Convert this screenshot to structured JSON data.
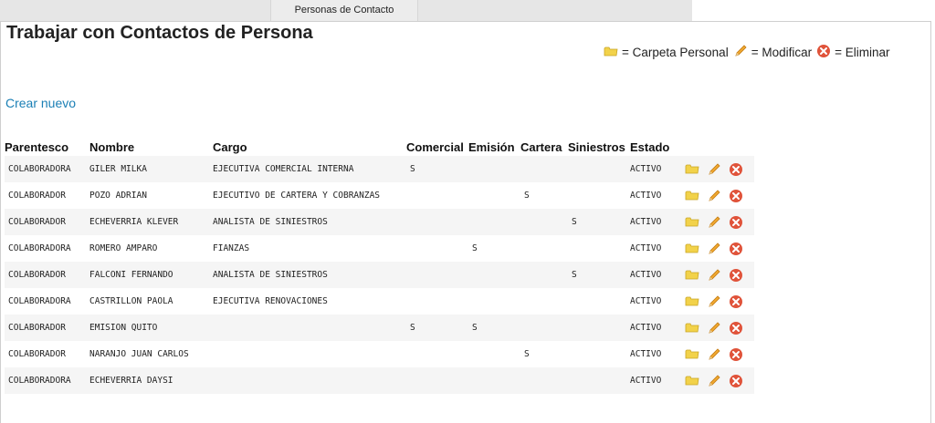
{
  "tabbar": {
    "active_tab": "Personas de Contacto"
  },
  "page": {
    "title": "Trabajar con Contactos de Persona",
    "create_link": "Crear nuevo"
  },
  "legend": {
    "folder_label": "= Carpeta Personal",
    "edit_label": "= Modificar",
    "delete_label": "= Eliminar",
    "folder_icon": "folder-icon",
    "edit_icon": "pencil-icon",
    "delete_icon": "delete-icon"
  },
  "table": {
    "headers": [
      "Parentesco",
      "Nombre",
      "Cargo",
      "Comercial",
      "Emisión",
      "Cartera",
      "Siniestros",
      "Estado"
    ],
    "rows": [
      {
        "parentesco": "COLABORADORA",
        "nombre": "GILER MILKA",
        "cargo": "EJECUTIVA COMERCIAL INTERNA",
        "comercial": "S",
        "emision": "",
        "cartera": "",
        "siniestros": "",
        "estado": "ACTIVO"
      },
      {
        "parentesco": "COLABORADOR",
        "nombre": "POZO ADRIAN",
        "cargo": "EJECUTIVO DE CARTERA Y COBRANZAS",
        "comercial": "",
        "emision": "",
        "cartera": "S",
        "siniestros": "",
        "estado": "ACTIVO"
      },
      {
        "parentesco": "COLABORADOR",
        "nombre": "ECHEVERRIA KLEVER",
        "cargo": "ANALISTA DE SINIESTROS",
        "comercial": "",
        "emision": "",
        "cartera": "",
        "siniestros": "S",
        "estado": "ACTIVO"
      },
      {
        "parentesco": "COLABORADORA",
        "nombre": "ROMERO AMPARO",
        "cargo": "FIANZAS",
        "comercial": "",
        "emision": "S",
        "cartera": "",
        "siniestros": "",
        "estado": "ACTIVO"
      },
      {
        "parentesco": "COLABORADOR",
        "nombre": "FALCONI FERNANDO",
        "cargo": "ANALISTA DE SINIESTROS",
        "comercial": "",
        "emision": "",
        "cartera": "",
        "siniestros": "S",
        "estado": "ACTIVO"
      },
      {
        "parentesco": "COLABORADORA",
        "nombre": "CASTRILLON PAOLA",
        "cargo": "EJECUTIVA RENOVACIONES",
        "comercial": "",
        "emision": "",
        "cartera": "",
        "siniestros": "",
        "estado": "ACTIVO"
      },
      {
        "parentesco": "COLABORADOR",
        "nombre": "EMISION QUITO",
        "cargo": "",
        "comercial": "S",
        "emision": "S",
        "cartera": "",
        "siniestros": "",
        "estado": "ACTIVO"
      },
      {
        "parentesco": "COLABORADOR",
        "nombre": "NARANJO JUAN CARLOS",
        "cargo": "",
        "comercial": "",
        "emision": "",
        "cartera": "S",
        "siniestros": "",
        "estado": "ACTIVO"
      },
      {
        "parentesco": "COLABORADORA",
        "nombre": "ECHEVERRIA DAYSI",
        "cargo": "",
        "comercial": "",
        "emision": "",
        "cartera": "",
        "siniestros": "",
        "estado": "ACTIVO"
      }
    ]
  },
  "colors": {
    "link": "#1a7fb5",
    "folder": "#f2d24a",
    "pencil": "#f0a830",
    "delete": "#e0533a"
  }
}
